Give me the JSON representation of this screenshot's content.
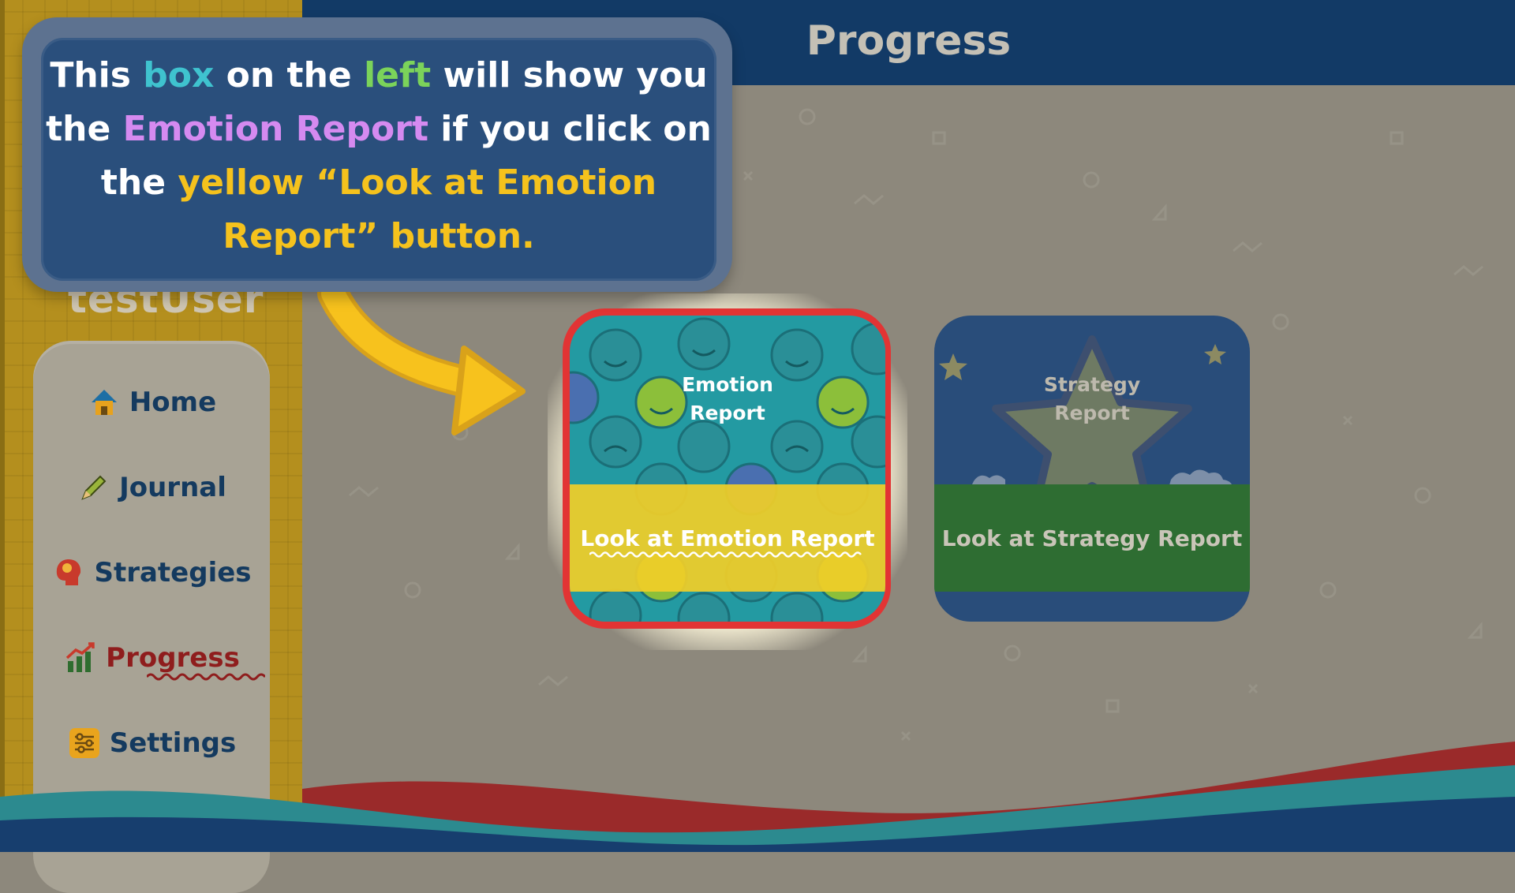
{
  "user": {
    "name": "testUser"
  },
  "header": {
    "title": "Progress"
  },
  "nav": {
    "items": [
      {
        "label": "Home",
        "icon": "home-icon"
      },
      {
        "label": "Journal",
        "icon": "pencil-icon"
      },
      {
        "label": "Strategies",
        "icon": "head-icon"
      },
      {
        "label": "Progress",
        "icon": "chart-icon",
        "active": true
      },
      {
        "label": "Settings",
        "icon": "sliders-icon"
      }
    ]
  },
  "cards": {
    "emotion": {
      "title_line1": "Emotion",
      "title_line2": "Report",
      "button": "Look at Emotion Report"
    },
    "strategy": {
      "title_line1": "Strategy",
      "title_line2": "Report",
      "button": "Look at Strategy Report"
    }
  },
  "tooltip": {
    "t1": "This ",
    "t2": "box",
    "t3": " on the ",
    "t4": "left",
    "t5": " will show you the ",
    "t6": "Emotion Report",
    "t7": " if you click on the ",
    "t8": "yellow “Look at Emotion Report” button."
  },
  "colors": {
    "header": "#123a66",
    "sidebar": "#b48f1e",
    "emotion_band": "#f0cd28",
    "strategy_band": "#2e6d32",
    "highlight_frame": "#e23434"
  }
}
